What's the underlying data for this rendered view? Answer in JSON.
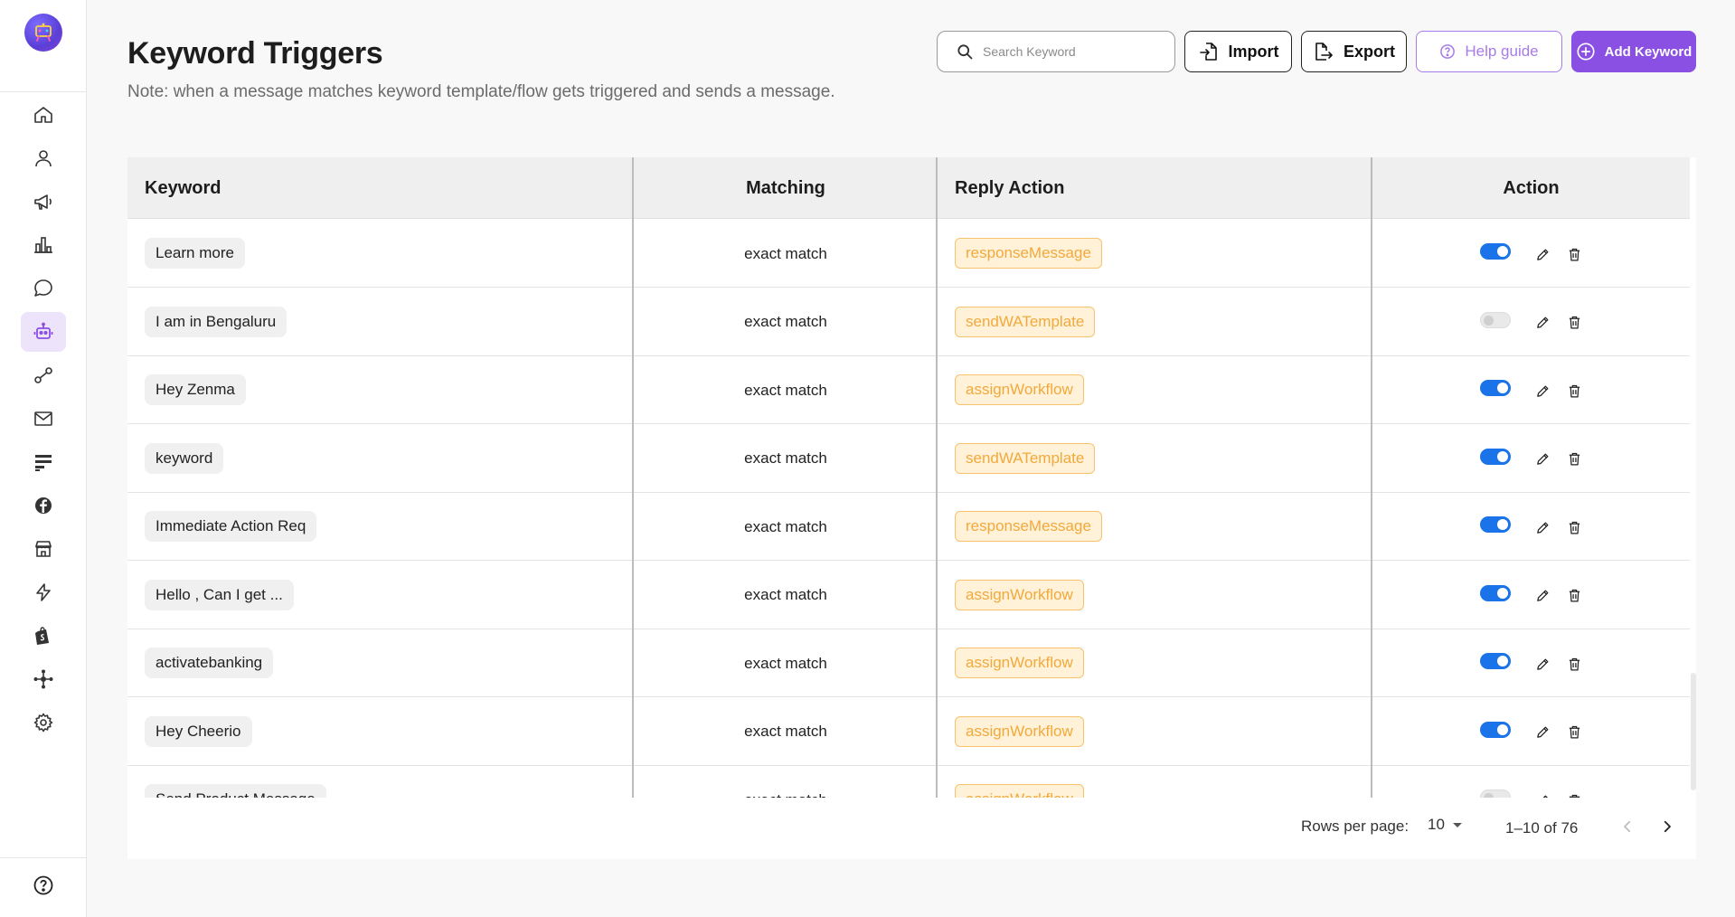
{
  "header": {
    "title": "Keyword Triggers",
    "note": "Note: when a message matches keyword template/flow gets triggered and sends a message."
  },
  "toolbar": {
    "search_placeholder": "Search Keyword",
    "import_label": "Import",
    "export_label": "Export",
    "help_label": "Help guide",
    "add_label": "Add Keyword"
  },
  "sidebar": {
    "items": [
      {
        "icon": "home-icon"
      },
      {
        "icon": "user-icon"
      },
      {
        "icon": "megaphone-icon"
      },
      {
        "icon": "bar-chart-icon"
      },
      {
        "icon": "chat-icon"
      },
      {
        "icon": "bot-icon",
        "active": true
      },
      {
        "icon": "flow-icon"
      },
      {
        "icon": "mail-icon"
      },
      {
        "icon": "form-icon"
      },
      {
        "icon": "facebook-icon"
      },
      {
        "icon": "store-icon"
      },
      {
        "icon": "lightning-icon"
      },
      {
        "icon": "shopify-icon"
      },
      {
        "icon": "integration-icon"
      },
      {
        "icon": "settings-icon"
      }
    ],
    "help_icon": "help-circle-icon"
  },
  "table": {
    "columns": [
      "Keyword",
      "Matching",
      "Reply Action",
      "Action"
    ],
    "rows": [
      {
        "keyword": "Learn more",
        "matching": "exact match",
        "reply": "responseMessage",
        "enabled": true
      },
      {
        "keyword": "I am in Bengaluru",
        "matching": "exact match",
        "reply": "sendWATemplate",
        "enabled": false
      },
      {
        "keyword": "Hey Zenma",
        "matching": "exact match",
        "reply": "assignWorkflow",
        "enabled": true
      },
      {
        "keyword": "keyword",
        "matching": "exact match",
        "reply": "sendWATemplate",
        "enabled": true
      },
      {
        "keyword": "Immediate Action Req",
        "matching": "exact match",
        "reply": "responseMessage",
        "enabled": true
      },
      {
        "keyword": "Hello , Can I get ...",
        "matching": "exact match",
        "reply": "assignWorkflow",
        "enabled": true
      },
      {
        "keyword": "activatebanking",
        "matching": "exact match",
        "reply": "assignWorkflow",
        "enabled": true
      },
      {
        "keyword": "Hey Cheerio",
        "matching": "exact match",
        "reply": "assignWorkflow",
        "enabled": true
      },
      {
        "keyword": "Send Product Message",
        "matching": "exact match",
        "reply": "assignWorkflow",
        "enabled": false
      }
    ]
  },
  "pagination": {
    "rows_per_page_label": "Rows per page:",
    "rows_per_page": "10",
    "range": "1–10 of 76"
  },
  "colors": {
    "accent": "#8a4fe3",
    "toggle_on": "#1a73e8",
    "reply_chip_text": "#f2a93b",
    "reply_chip_bg": "#fff2d9"
  }
}
